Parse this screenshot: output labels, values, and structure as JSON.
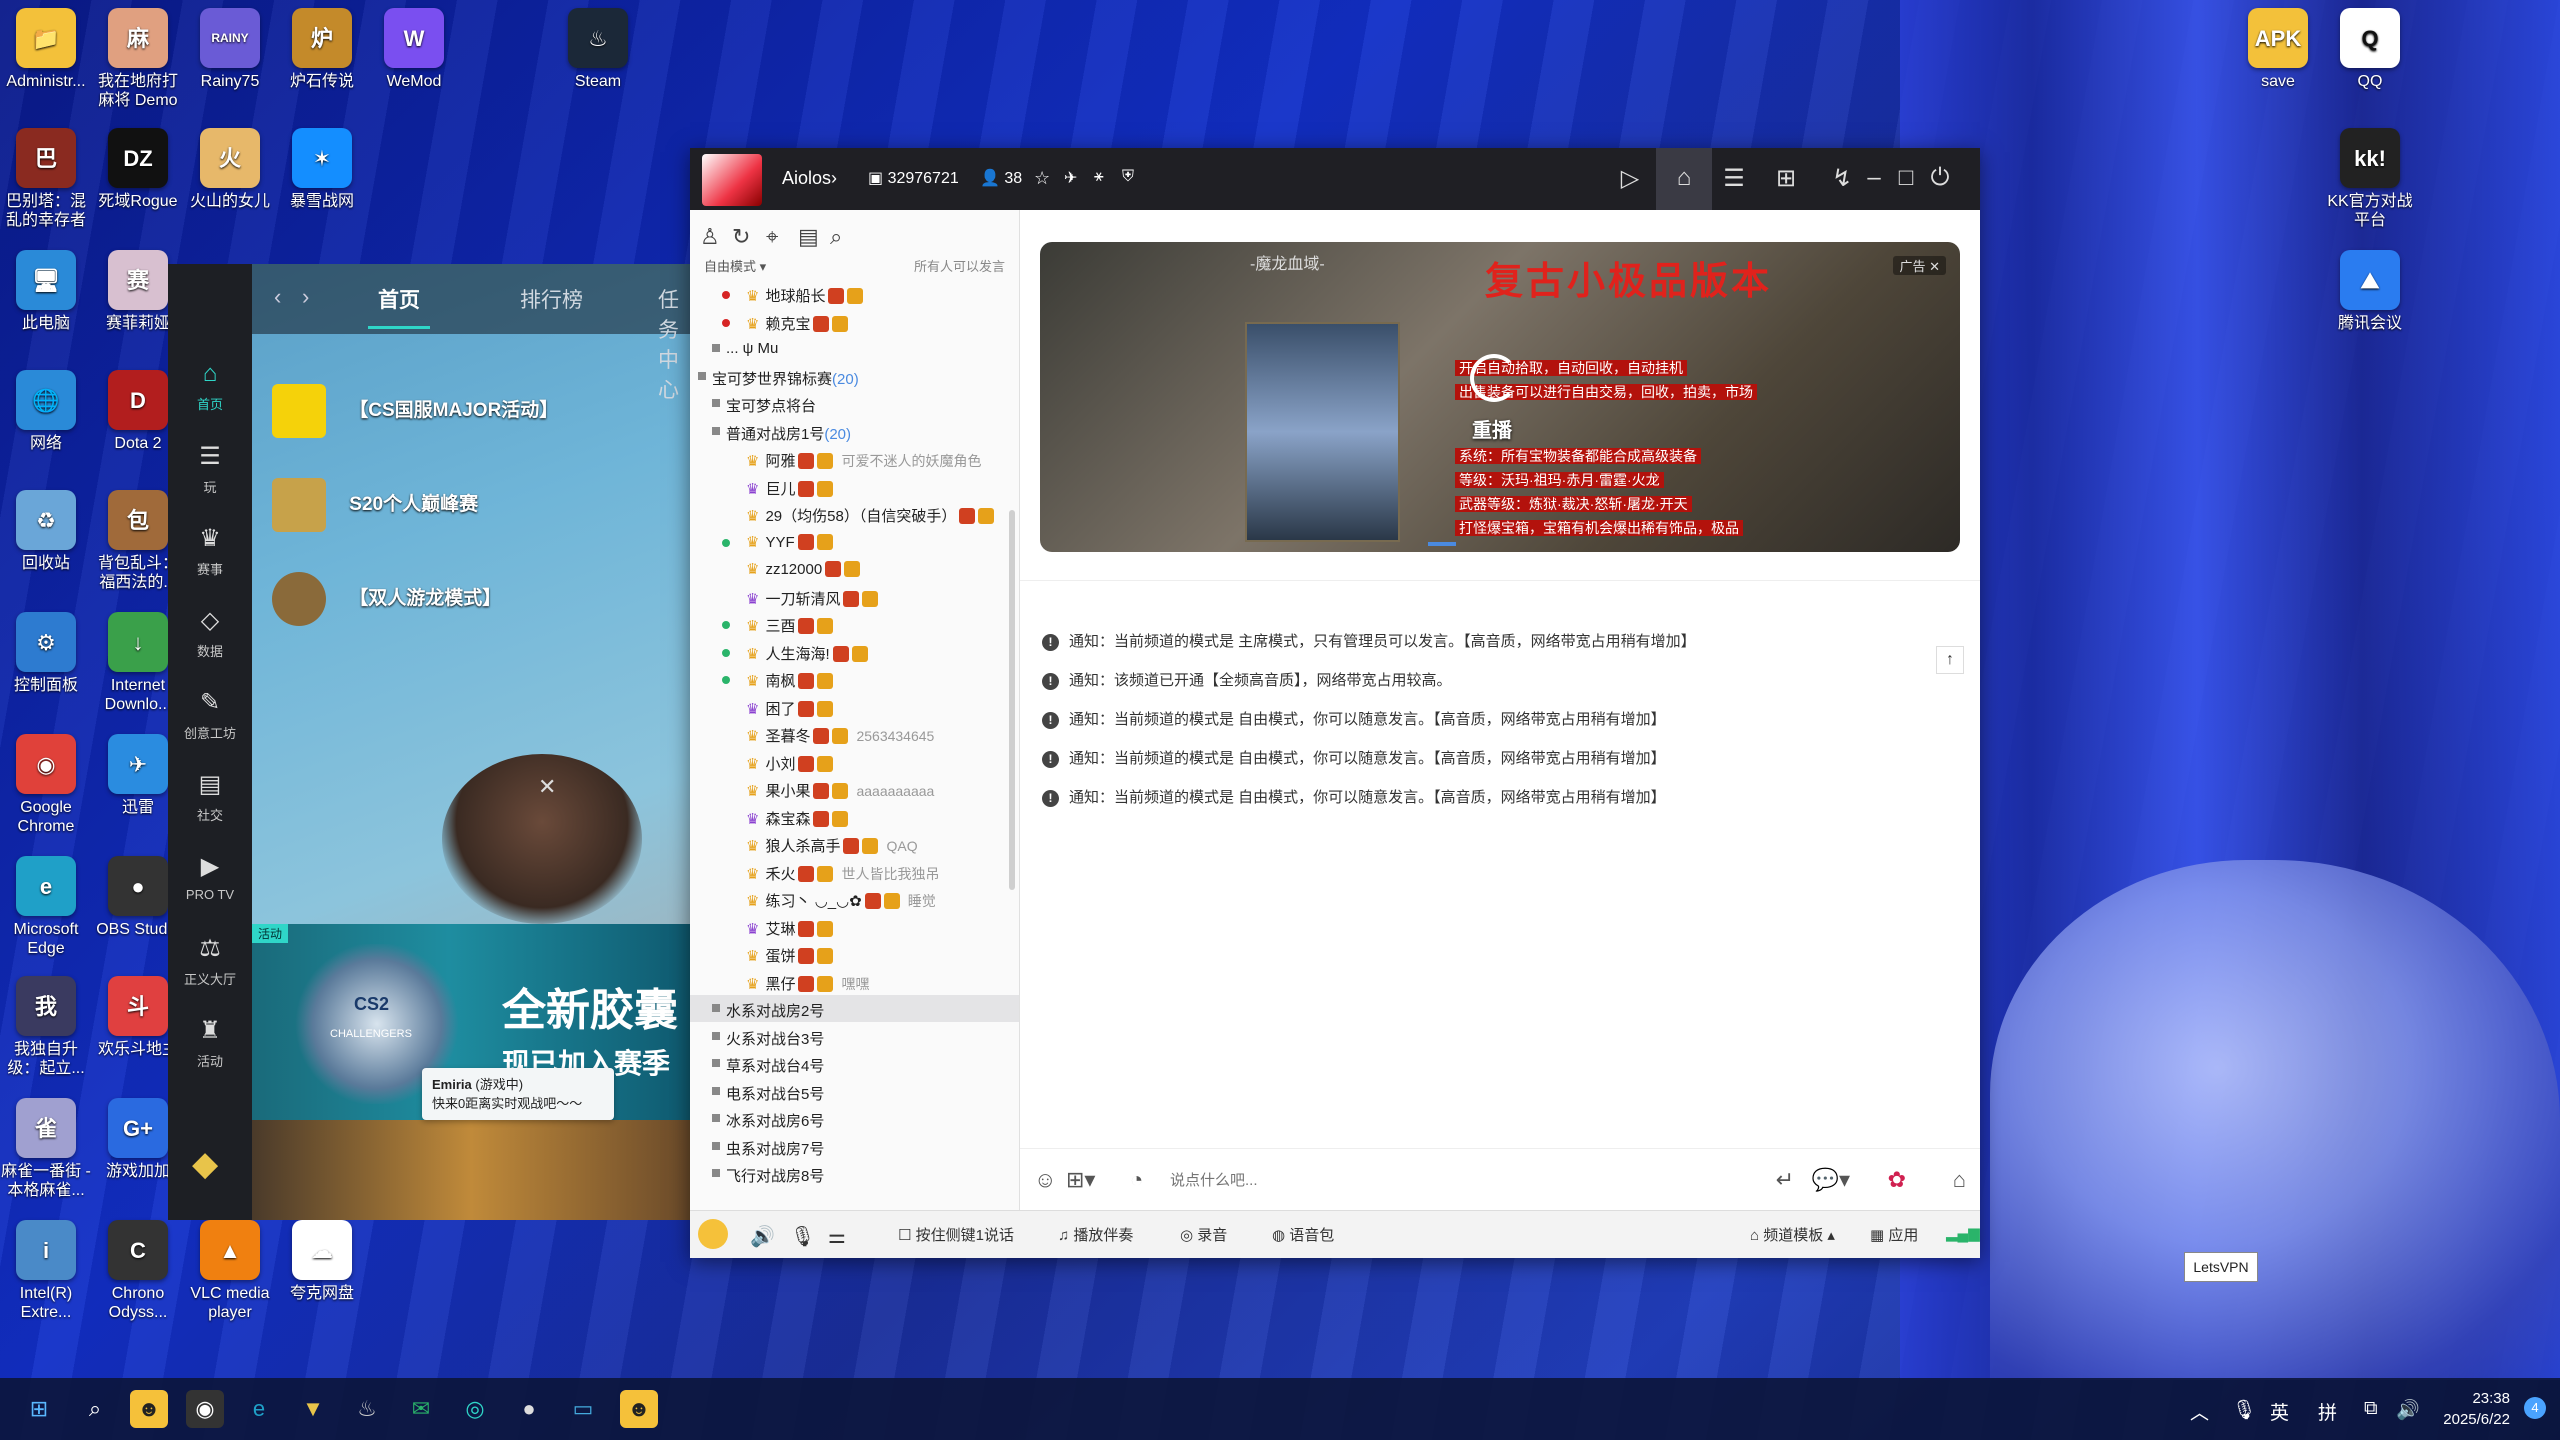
{
  "desktop": {
    "icons_left": [
      {
        "label": "Administr...",
        "glyph": "📁",
        "color": "#f3c13a"
      },
      {
        "label": "我在地府打麻将 Demo",
        "glyph": "麻",
        "color": "#e0a080"
      },
      {
        "label": "Rainy75",
        "glyph": "RAINY",
        "color": "#6a5bd6"
      },
      {
        "label": "炉石传说",
        "glyph": "炉",
        "color": "#c48a2a"
      },
      {
        "label": "WeMod",
        "glyph": "W",
        "color": "#7a4ff0"
      },
      {
        "label": "Steam",
        "glyph": "♨",
        "color": "#1b2838"
      },
      {
        "label": "巴别塔：混乱的幸存者",
        "glyph": "巴",
        "color": "#8a2a20"
      },
      {
        "label": "死域Rogue",
        "glyph": "DZ",
        "color": "#111"
      },
      {
        "label": "火山的女儿",
        "glyph": "火",
        "color": "#e7b86a"
      },
      {
        "label": "暴雪战网",
        "glyph": "✶",
        "color": "#148eff"
      },
      {
        "label": "此电脑",
        "glyph": "🖥",
        "color": "#2a8ad8"
      },
      {
        "label": "赛菲莉娅",
        "glyph": "赛",
        "color": "#d8c0d0"
      },
      {
        "label": "网络",
        "glyph": "🌐",
        "color": "#2a8ad8"
      },
      {
        "label": "Dota 2",
        "glyph": "D",
        "color": "#b21e1e"
      },
      {
        "label": "回收站",
        "glyph": "♻",
        "color": "#6aa6d8"
      },
      {
        "label": "背包乱斗：福西法的...",
        "glyph": "包",
        "color": "#a06a3a"
      },
      {
        "label": "控制面板",
        "glyph": "⚙",
        "color": "#2d7bd0"
      },
      {
        "label": "Internet Downlo...",
        "glyph": "↓",
        "color": "#3aa04a"
      },
      {
        "label": "Google Chrome",
        "glyph": "◉",
        "color": "#e0413a"
      },
      {
        "label": "迅雷",
        "glyph": "✈",
        "color": "#2a8ce0"
      },
      {
        "label": "Microsoft Edge",
        "glyph": "e",
        "color": "#1fa0c8"
      },
      {
        "label": "OBS Studio",
        "glyph": "●",
        "color": "#333"
      },
      {
        "label": "我独自升级：起立...",
        "glyph": "我",
        "color": "#3a3a60"
      },
      {
        "label": "欢乐斗地主",
        "glyph": "斗",
        "color": "#e04040"
      },
      {
        "label": "麻雀一番街 - 本格麻雀...",
        "glyph": "雀",
        "color": "#a0a0d0"
      },
      {
        "label": "游戏加加",
        "glyph": "G+",
        "color": "#2a6ae0"
      },
      {
        "label": "Intel(R) Extre...",
        "glyph": "i",
        "color": "#4a8ac8"
      },
      {
        "label": "Chrono Odyss...",
        "glyph": "C",
        "color": "#333"
      },
      {
        "label": "VLC media player",
        "glyph": "▲",
        "color": "#f08010"
      },
      {
        "label": "夸克网盘",
        "glyph": "☁",
        "color": "#fff"
      }
    ],
    "icons_right": [
      {
        "label": "save",
        "glyph": "APK",
        "color": "#f3c13a"
      },
      {
        "label": "QQ",
        "glyph": "Q",
        "color": "#fff"
      },
      {
        "label": "KK官方对战平台",
        "glyph": "kk!",
        "color": "#222"
      },
      {
        "label": "腾讯会议",
        "glyph": "⛰",
        "color": "#2a7cf0"
      }
    ]
  },
  "game_app": {
    "tabs": [
      "首页",
      "排行榜",
      "任务中心"
    ],
    "sidebar": [
      {
        "label": "首页",
        "glyph": "⌂"
      },
      {
        "label": "玩",
        "glyph": "☰"
      },
      {
        "label": "赛事",
        "glyph": "♛"
      },
      {
        "label": "数据",
        "glyph": "◇"
      },
      {
        "label": "创意工坊",
        "glyph": "✎"
      },
      {
        "label": "社交",
        "glyph": "▤"
      },
      {
        "label": "PRO TV",
        "glyph": "▶"
      },
      {
        "label": "正义大厅",
        "glyph": "⚖"
      },
      {
        "label": "活动",
        "glyph": "♜"
      }
    ],
    "events": [
      "【CS国服MAJOR活动】",
      "S20个人巅峰赛",
      "【双人游龙模式】"
    ],
    "toast": {
      "name": "Emiria",
      "status": "(游戏中)",
      "message": "快来0距离实时观战吧～～"
    },
    "banner": {
      "tag": "活动",
      "line1": "全新胶囊",
      "line2": "现已加入赛季",
      "capsule": "CS2",
      "capsule_sub": "CHALLENGERS"
    }
  },
  "chat": {
    "title": "Aiolos",
    "channel_id": "32976721",
    "online": "38",
    "mode_label": "自由模式",
    "mode_right": "所有人可以发言",
    "tree": [
      {
        "text": "地球船长",
        "indent": 2,
        "dot": "#d62424"
      },
      {
        "text": "赖克宝",
        "indent": 2,
        "dot": "#d62424"
      },
      {
        "text": "... ψ Mu",
        "indent": 1,
        "dot": ""
      },
      {
        "text": "宝可梦世界锦标赛",
        "count": "(20)",
        "indent": 0,
        "dot": ""
      },
      {
        "text": "宝可梦点将台",
        "indent": 1,
        "dot": ""
      },
      {
        "text": "普通对战房1号",
        "count": "(20)",
        "indent": 1,
        "dot": ""
      },
      {
        "text": "阿雅",
        "sig": "可爱不迷人的妖魔角色",
        "indent": 2,
        "dot": ""
      },
      {
        "text": "巨儿",
        "indent": 2,
        "dot": ""
      },
      {
        "text": "29（均伤58）（自信突破手）",
        "indent": 2,
        "dot": ""
      },
      {
        "text": "YYF",
        "indent": 2,
        "dot": "#2ab46a"
      },
      {
        "text": "zz12000",
        "indent": 2,
        "dot": ""
      },
      {
        "text": "一刀斩清风",
        "indent": 2,
        "dot": ""
      },
      {
        "text": "三酉",
        "indent": 2,
        "dot": "#2ab46a"
      },
      {
        "text": "人生海海!",
        "indent": 2,
        "dot": "#2ab46a"
      },
      {
        "text": "南枫",
        "indent": 2,
        "dot": "#2ab46a"
      },
      {
        "text": "困了",
        "indent": 2,
        "dot": ""
      },
      {
        "text": "圣暮冬",
        "sig": "2563434645",
        "indent": 2,
        "dot": ""
      },
      {
        "text": "小刘",
        "indent": 2,
        "dot": ""
      },
      {
        "text": "果小果",
        "sig": "aaaaaaaaaa",
        "indent": 2,
        "dot": ""
      },
      {
        "text": "森宝森",
        "indent": 2,
        "dot": ""
      },
      {
        "text": "狼人杀高手",
        "sig": "QAQ",
        "indent": 2,
        "dot": ""
      },
      {
        "text": "禾火",
        "sig": "世人皆比我独吊",
        "indent": 2,
        "dot": ""
      },
      {
        "text": "练习丶 ◡_◡✿",
        "sig": "睡觉",
        "indent": 2,
        "dot": ""
      },
      {
        "text": "艾琳",
        "indent": 2,
        "dot": ""
      },
      {
        "text": "蛋饼",
        "indent": 2,
        "dot": ""
      },
      {
        "text": "黑仔",
        "sig": "嘿嘿",
        "indent": 2,
        "dot": ""
      },
      {
        "text": "水系对战房2号",
        "indent": 1,
        "dot": "",
        "selected": true
      },
      {
        "text": "火系对战台3号",
        "indent": 1,
        "dot": ""
      },
      {
        "text": "草系对战台4号",
        "indent": 1,
        "dot": ""
      },
      {
        "text": "电系对战台5号",
        "indent": 1,
        "dot": ""
      },
      {
        "text": "冰系对战房6号",
        "indent": 1,
        "dot": ""
      },
      {
        "text": "虫系对战房7号",
        "indent": 1,
        "dot": ""
      },
      {
        "text": "飞行对战房8号",
        "indent": 1,
        "dot": ""
      }
    ],
    "ad": {
      "sub": "-魔龙血域-",
      "title": "复古小极品版本",
      "close": "广告 ✕",
      "lines": [
        "开启自动拾取，自动回收，自动挂机",
        "出售装备可以进行自由交易，回收，拍卖，市场",
        "重播",
        "系统：所有宝物装备都能合成高级装备",
        "等级：沃玛·祖玛·赤月·雷霆·火龙",
        "武器等级：炼狱·裁决·怒斩·屠龙·开天",
        "打怪爆宝箱，宝箱有机会爆出稀有饰品，极品"
      ],
      "replay": "重播"
    },
    "notices": [
      "通知：当前频道的模式是 主席模式，只有管理员可以发言。【高音质，网络带宽占用稍有增加】",
      "通知：该频道已开通【全频高音质】，网络带宽占用较高。",
      "通知：当前频道的模式是 自由模式，你可以随意发言。【高音质，网络带宽占用稍有增加】",
      "通知：当前频道的模式是 自由模式，你可以随意发言。【高音质，网络带宽占用稍有增加】",
      "通知：当前频道的模式是 自由模式，你可以随意发言。【高音质，网络带宽占用稍有增加】"
    ],
    "input_placeholder": "说点什么吧...",
    "bottom": {
      "ptt": "按住侧键1说话",
      "accompany": "播放伴奏",
      "record": "录音",
      "voice_pack": "语音包",
      "template": "频道模板",
      "apps": "应用"
    }
  },
  "tooltip_vpn": "LetsVPN",
  "taskbar": {
    "ime1": "英",
    "ime2": "拼",
    "time": "23:38",
    "date": "2025/6/22",
    "notifications": "4"
  }
}
